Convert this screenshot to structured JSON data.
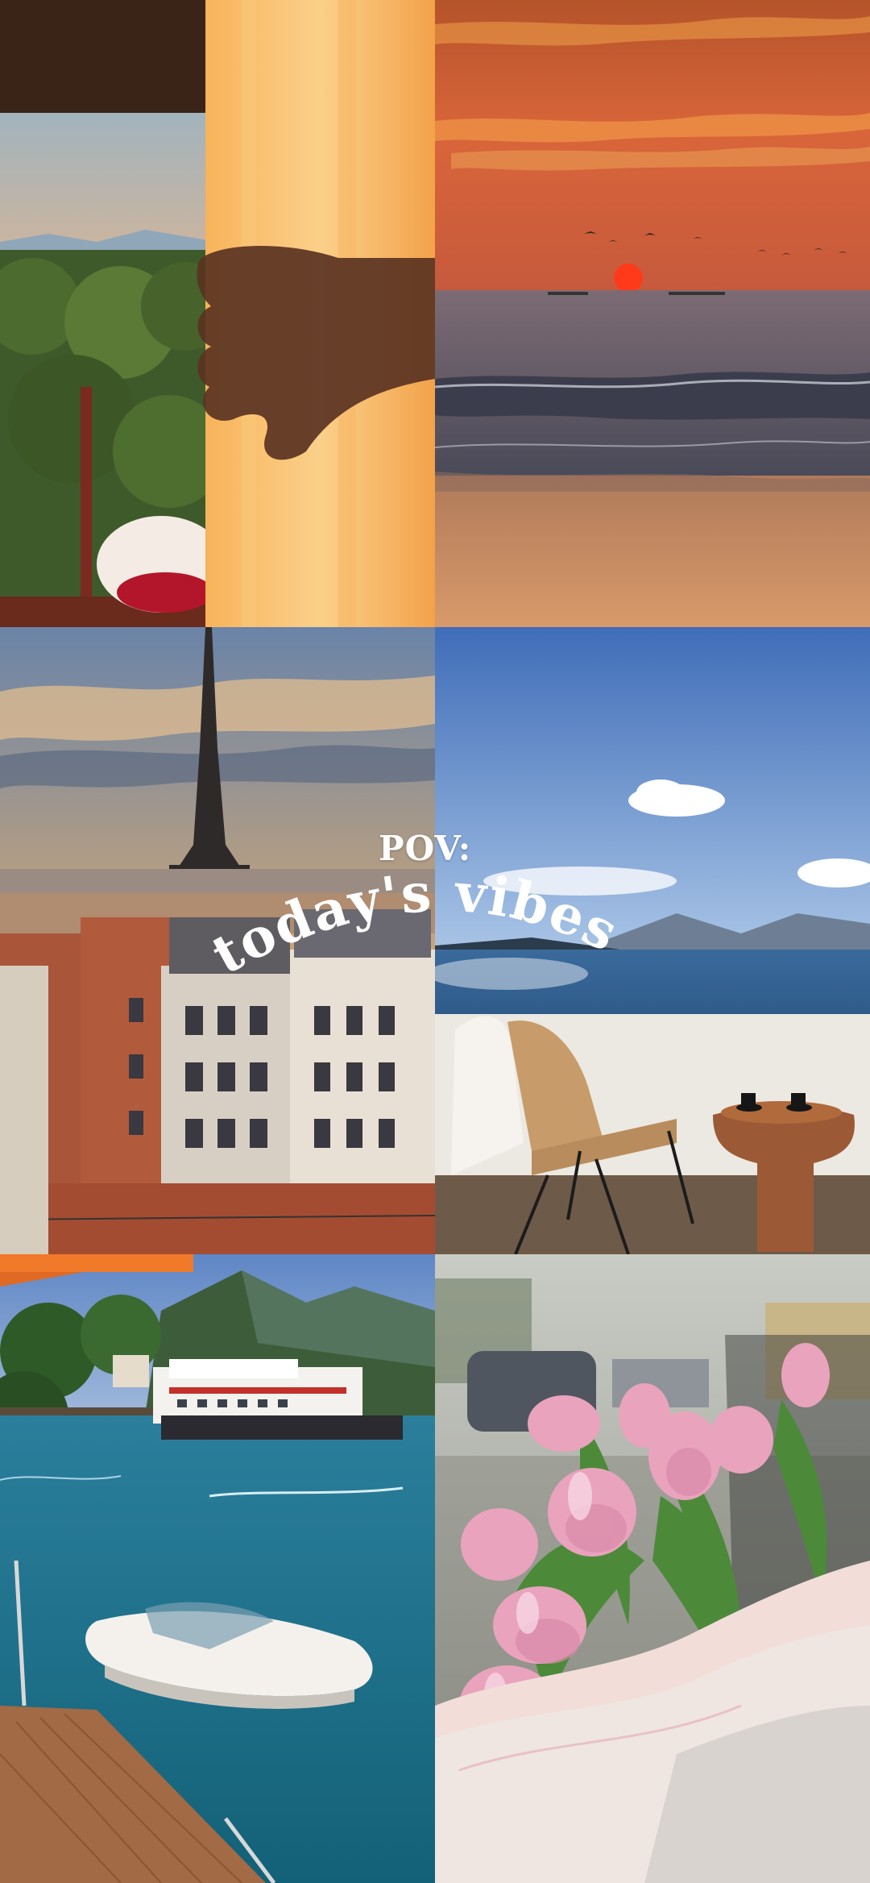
{
  "overlay": {
    "line1": "POV:",
    "line2": "today's vibes"
  },
  "tiles": [
    {
      "name": "curtain-sunset-view"
    },
    {
      "name": "beach-sunset"
    },
    {
      "name": "eiffel-tower-rooftops"
    },
    {
      "name": "balcony-sea-view"
    },
    {
      "name": "lake-boats-harbor"
    },
    {
      "name": "pink-tulips-bouquet"
    }
  ],
  "colors": {
    "sunset_orange": "#e8732e",
    "sky_blue": "#5b86c4",
    "lake_teal": "#1f6f8c",
    "tulip_pink": "#e9a3bd"
  }
}
